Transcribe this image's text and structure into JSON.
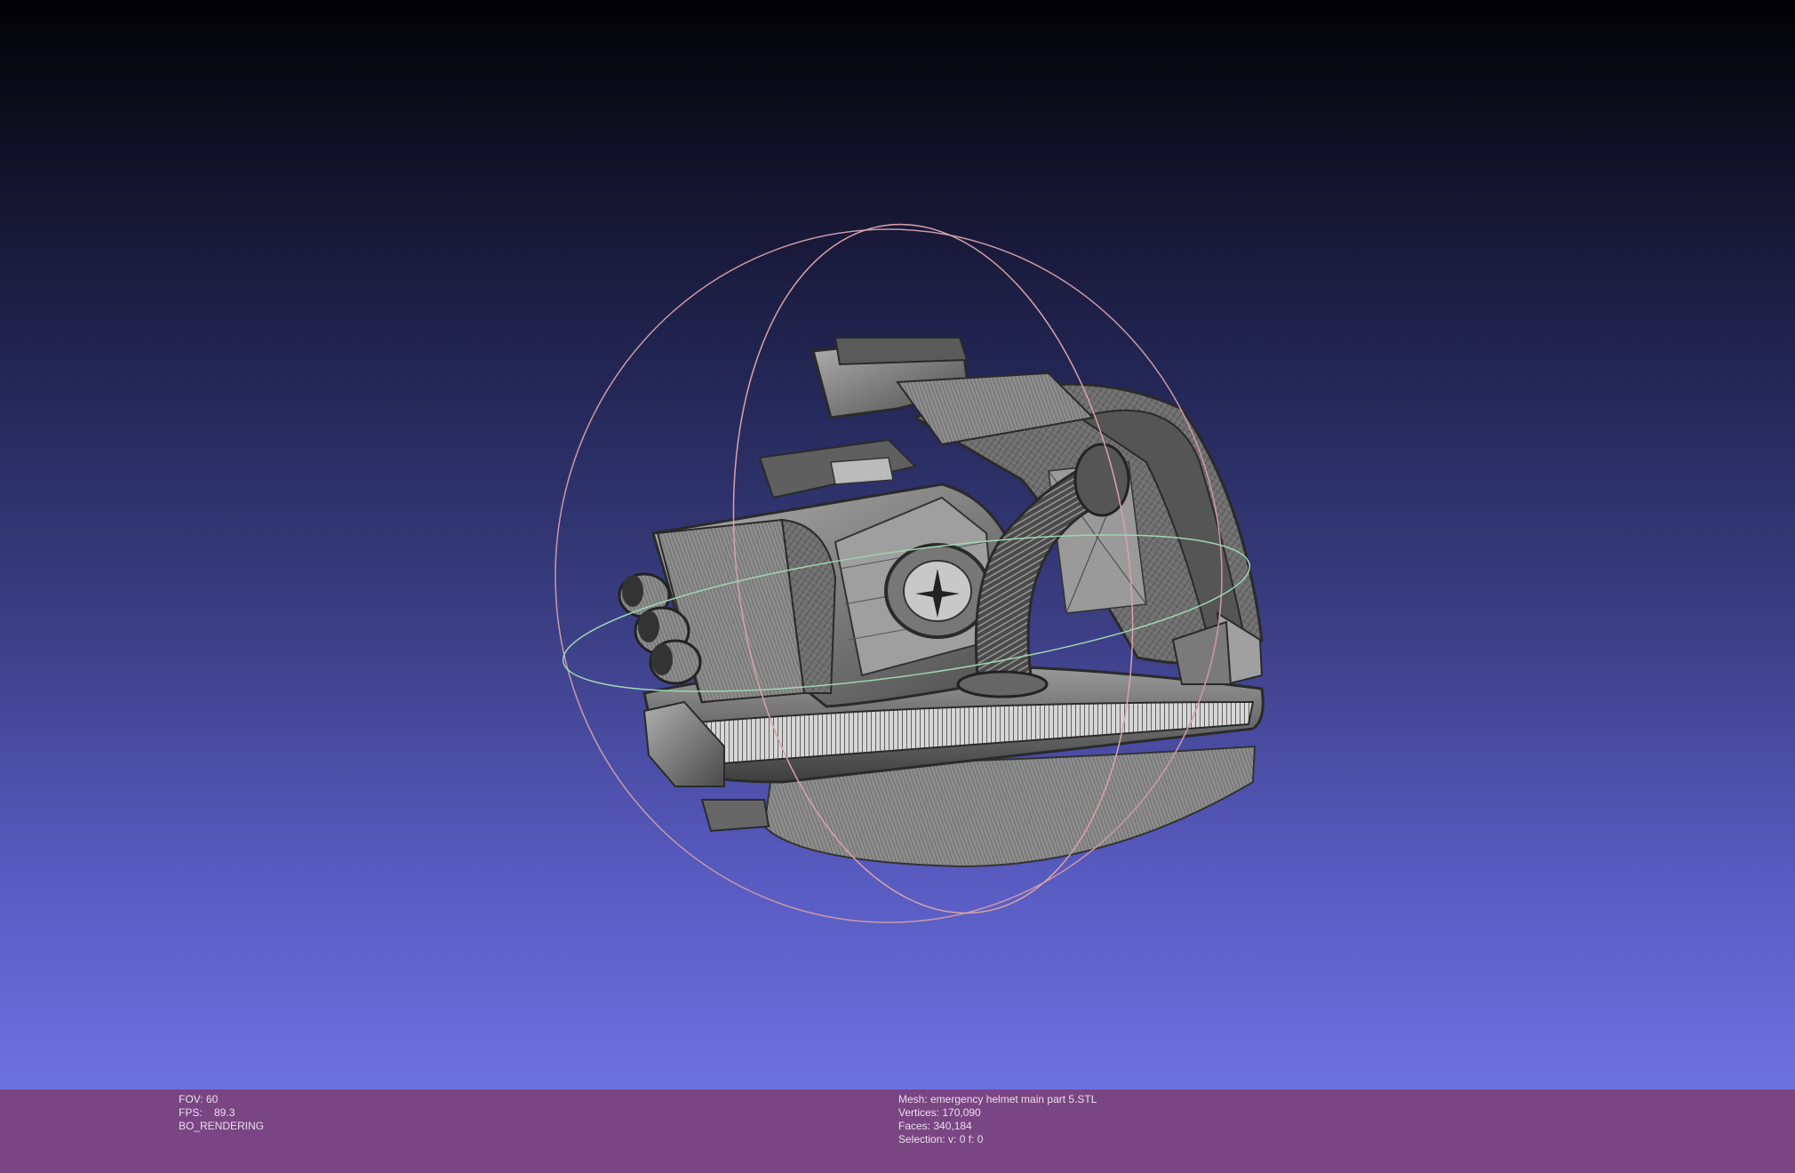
{
  "viewport": {
    "background_top": "#020204",
    "background_bottom": "#6e71e1",
    "model_color": "#8a8a8a",
    "trackball_colors": [
      "#d89aa0",
      "#9ad8a8",
      "#c0a0c0"
    ]
  },
  "info_left": {
    "fov": "FOV: 60",
    "fps": "FPS:    89.3",
    "mode": "BO_RENDERING"
  },
  "info_right": {
    "mesh": "Mesh: emergency helmet main part 5.STL",
    "vertices": "Vertices: 170,090",
    "faces": "Faces: 340,184",
    "selection": "Selection: v: 0 f: 0"
  },
  "info_bar_color": "#7a4583"
}
